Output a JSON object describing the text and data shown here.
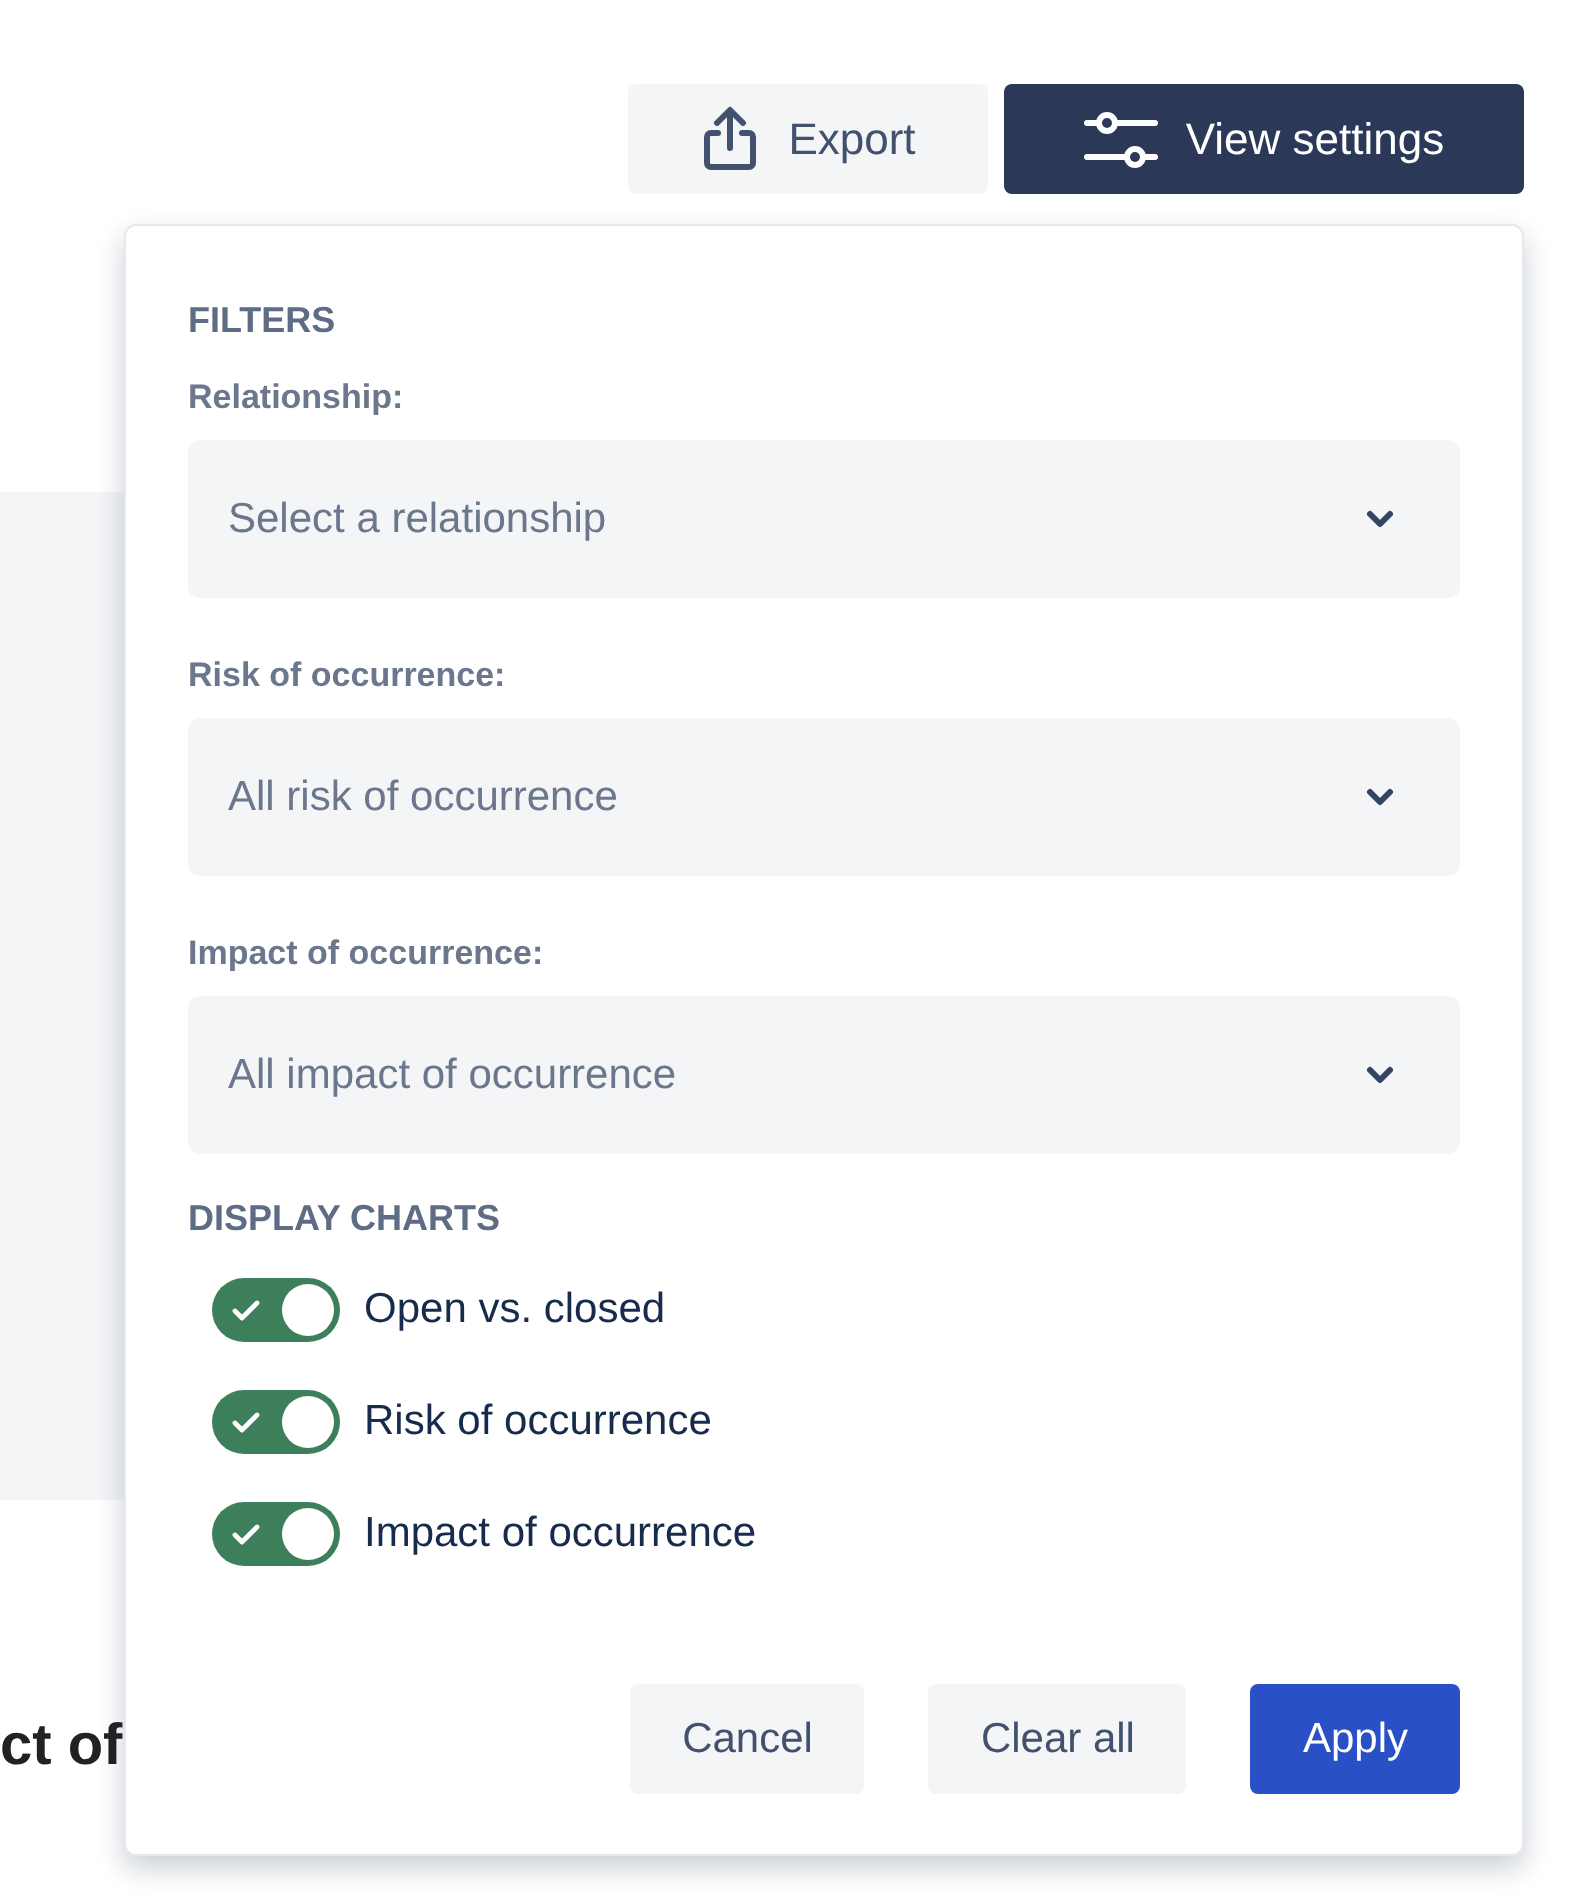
{
  "toolbar": {
    "buttons": [
      {
        "label": "Export",
        "kind": "secondary"
      },
      {
        "label": "View settings",
        "kind": "primary"
      }
    ]
  },
  "page": {
    "heading": "ct of"
  },
  "popover": {
    "filters_title": "FILTERS",
    "filters": [
      {
        "label": "Relationship:",
        "placeholder": "Select a relationship"
      },
      {
        "label": "Risk of occurrence:",
        "placeholder": "All risk of occurrence"
      },
      {
        "label": "Impact of occurrence:",
        "placeholder": "All impact of occurrence"
      }
    ],
    "charts_title": "DISPLAY CHARTS",
    "charts": [
      {
        "label": "Open vs. closed",
        "on": true
      },
      {
        "label": "Risk of occurrence",
        "on": true
      },
      {
        "label": "Impact of occurrence",
        "on": true
      }
    ],
    "buttons": [
      {
        "label": "Cancel",
        "kind": "secondary"
      },
      {
        "label": "Clear all",
        "kind": "secondary"
      },
      {
        "label": "Apply",
        "kind": "primary"
      }
    ]
  }
}
